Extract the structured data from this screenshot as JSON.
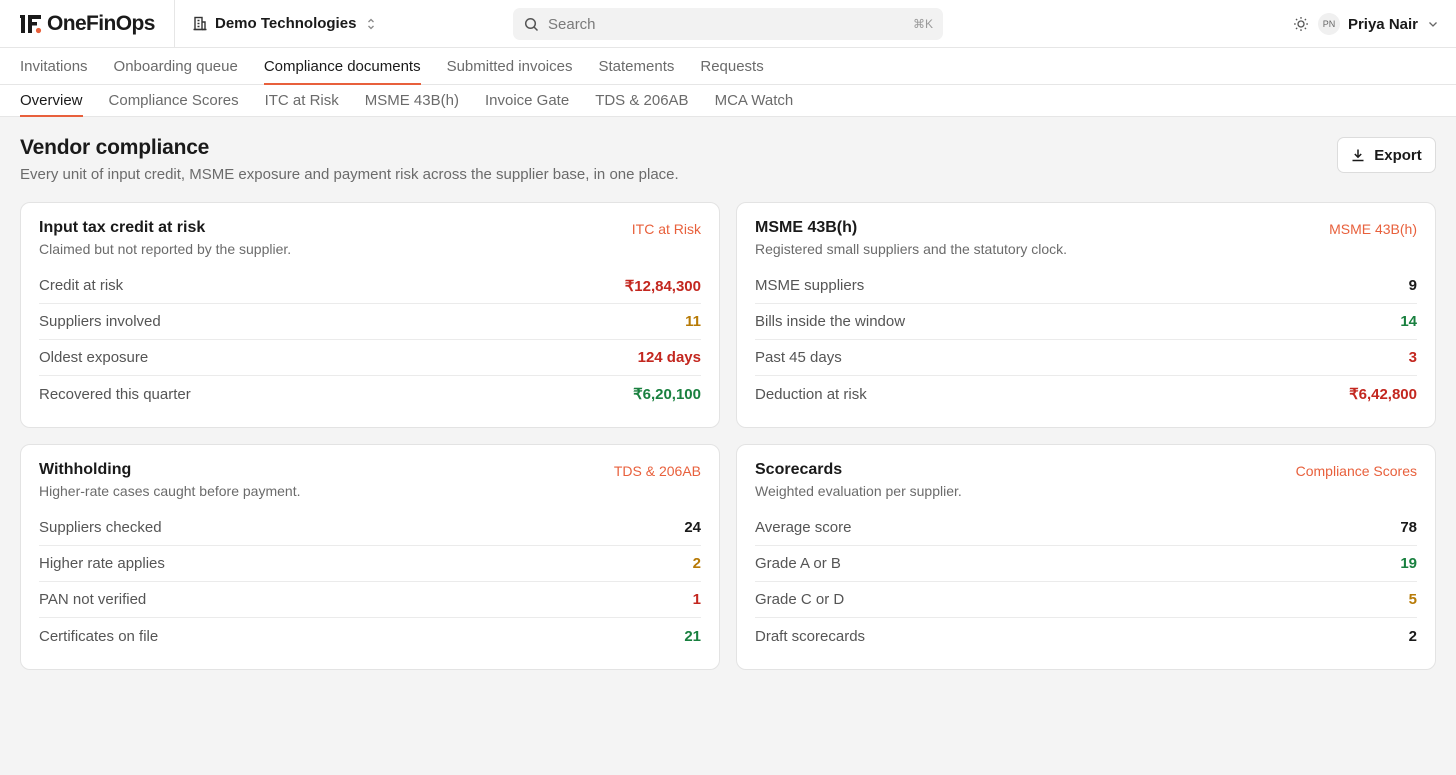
{
  "brand": {
    "name": "OneFinOps",
    "accent": "#e8603c"
  },
  "org": {
    "name": "Demo Technologies"
  },
  "search": {
    "placeholder": "Search",
    "shortcut": "⌘K"
  },
  "user": {
    "initials": "PN",
    "name": "Priya Nair"
  },
  "primary_tabs": [
    {
      "label": "Invitations",
      "active": false
    },
    {
      "label": "Onboarding queue",
      "active": false
    },
    {
      "label": "Compliance documents",
      "active": true
    },
    {
      "label": "Submitted invoices",
      "active": false
    },
    {
      "label": "Statements",
      "active": false
    },
    {
      "label": "Requests",
      "active": false
    }
  ],
  "secondary_tabs": [
    {
      "label": "Overview",
      "active": true
    },
    {
      "label": "Compliance Scores",
      "active": false
    },
    {
      "label": "ITC at Risk",
      "active": false
    },
    {
      "label": "MSME 43B(h)",
      "active": false
    },
    {
      "label": "Invoice Gate",
      "active": false
    },
    {
      "label": "TDS & 206AB",
      "active": false
    },
    {
      "label": "MCA Watch",
      "active": false
    }
  ],
  "page": {
    "title": "Vendor compliance",
    "subtitle": "Every unit of input credit, MSME exposure and payment risk across the supplier base, in one place.",
    "export_label": "Export"
  },
  "status_colors": {
    "red": "#c3271f",
    "amber": "#b77a06",
    "green": "#19803f",
    "dark": "#1a1a1a"
  },
  "cards": [
    {
      "title": "Input tax credit at risk",
      "link": "ITC at Risk",
      "subtitle": "Claimed but not reported by the supplier.",
      "rows": [
        {
          "label": "Credit at risk",
          "value": "₹12,84,300",
          "tone": "red"
        },
        {
          "label": "Suppliers involved",
          "value": "11",
          "tone": "amber"
        },
        {
          "label": "Oldest exposure",
          "value": "124 days",
          "tone": "red"
        },
        {
          "label": "Recovered this quarter",
          "value": "₹6,20,100",
          "tone": "green"
        }
      ]
    },
    {
      "title": "MSME 43B(h)",
      "link": "MSME 43B(h)",
      "subtitle": "Registered small suppliers and the statutory clock.",
      "rows": [
        {
          "label": "MSME suppliers",
          "value": "9",
          "tone": "dark"
        },
        {
          "label": "Bills inside the window",
          "value": "14",
          "tone": "green"
        },
        {
          "label": "Past 45 days",
          "value": "3",
          "tone": "red"
        },
        {
          "label": "Deduction at risk",
          "value": "₹6,42,800",
          "tone": "red"
        }
      ]
    },
    {
      "title": "Withholding",
      "link": "TDS & 206AB",
      "subtitle": "Higher-rate cases caught before payment.",
      "rows": [
        {
          "label": "Suppliers checked",
          "value": "24",
          "tone": "dark"
        },
        {
          "label": "Higher rate applies",
          "value": "2",
          "tone": "amber"
        },
        {
          "label": "PAN not verified",
          "value": "1",
          "tone": "red"
        },
        {
          "label": "Certificates on file",
          "value": "21",
          "tone": "green"
        }
      ]
    },
    {
      "title": "Scorecards",
      "link": "Compliance Scores",
      "subtitle": "Weighted evaluation per supplier.",
      "rows": [
        {
          "label": "Average score",
          "value": "78",
          "tone": "dark"
        },
        {
          "label": "Grade A or B",
          "value": "19",
          "tone": "green"
        },
        {
          "label": "Grade C or D",
          "value": "5",
          "tone": "amber"
        },
        {
          "label": "Draft scorecards",
          "value": "2",
          "tone": "dark"
        }
      ]
    }
  ]
}
